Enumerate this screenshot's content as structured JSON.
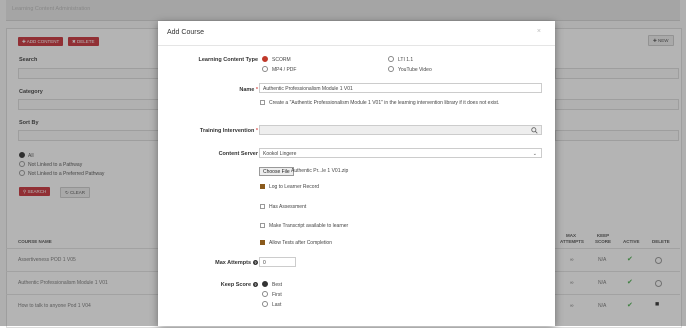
{
  "background": {
    "title": "Learning Content Administration",
    "buttons": {
      "add_content": "✚ ADD CONTENT",
      "delete": "✖ DELETE",
      "new": "✚ NEW",
      "search": "⚲ SEARCH",
      "clear": "↻ CLEAR"
    },
    "filters": {
      "search_label": "Search",
      "category_label": "Category",
      "sort_by_label": "Sort By"
    },
    "pathway_options": [
      "All",
      "Not Linked to a Pathway",
      "Not Linked to a Preferred Pathway"
    ],
    "table": {
      "columns": {
        "course_name": "COURSE NAME",
        "max_attempts": "MAX ATTEMPTS",
        "keep_score": "KEEP SCORE",
        "active": "ACTIVE",
        "delete": "DELETE"
      },
      "rows": [
        {
          "name": "Assertiveness POD 1 V05",
          "max_attempts": "∞",
          "keep_score": "N/A"
        },
        {
          "name": "Authentic Professionalism Module 1 V01",
          "max_attempts": "∞",
          "keep_score": "N/A"
        },
        {
          "name": "How to talk to anyone Pod 1 V04",
          "max_attempts": "∞",
          "keep_score": "N/A"
        }
      ]
    }
  },
  "modal": {
    "title": "Add Course",
    "close": "×",
    "content_type": {
      "label": "Learning Content Type",
      "options": {
        "scorm": "SCORM",
        "lti": "LTI 1.1",
        "mp4": "MP4 / PDF",
        "youtube": "YouTube Video"
      }
    },
    "name": {
      "label": "Name",
      "value": "Authentic Professionalism Module 1 V01",
      "create_checkbox": "Create a \"Authentic Professionalism Module 1 V01\" in the learning intervention library if it does not exist."
    },
    "training_intervention": {
      "label": "Training Intervention",
      "value": ""
    },
    "content_server": {
      "label": "Content Server",
      "value": "Kookol Lingere"
    },
    "file": {
      "button": "Choose File",
      "name": "Authentic Pr...le 1 V01.zip"
    },
    "options": {
      "log_to_learner": "Log to Learner Record",
      "has_assessment": "Has Assessment",
      "make_transcript": "Make Transcript available to learner",
      "allow_tests": "Allow Tests after Completion"
    },
    "max_attempts": {
      "label": "Max Attempts",
      "value": "0"
    },
    "keep_score": {
      "label": "Keep Score",
      "options": [
        "Best",
        "First",
        "Last"
      ]
    }
  },
  "colors": {
    "accent": "#c9333b",
    "check_on": "#8a5a1c",
    "active_check": "#4caf50"
  }
}
